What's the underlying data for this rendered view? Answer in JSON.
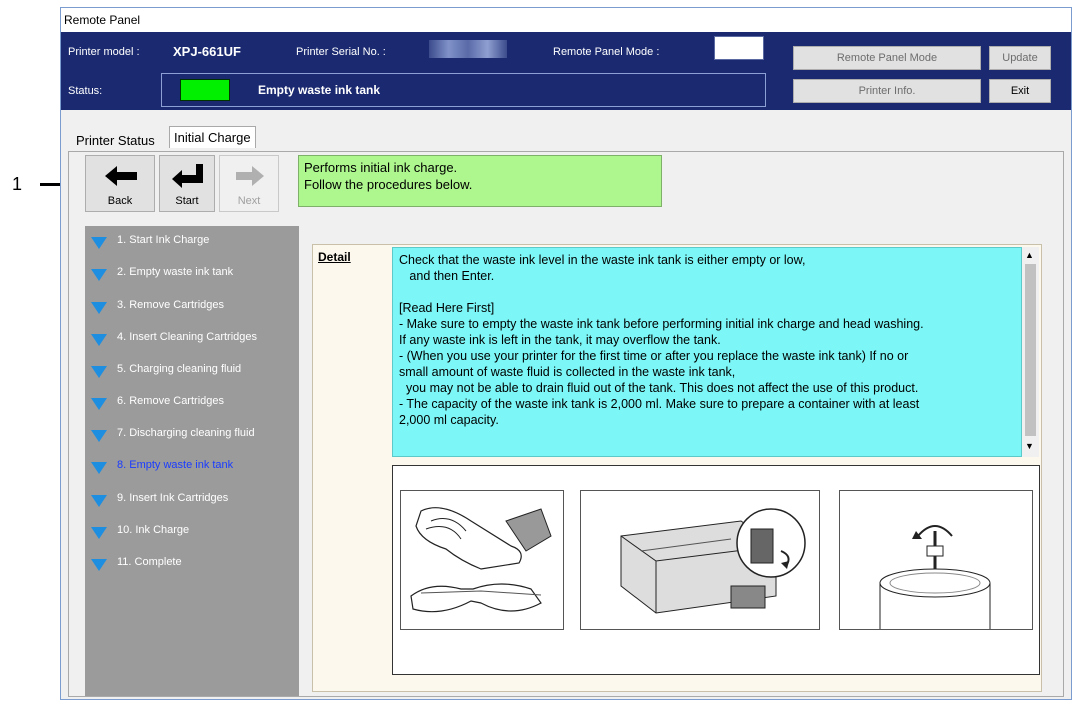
{
  "callout": {
    "number": "1"
  },
  "window": {
    "title": "Remote Panel"
  },
  "header": {
    "printer_model_label": "Printer model :",
    "printer_model_value": "XPJ-661UF",
    "serial_label": "Printer Serial No. :",
    "remote_mode_label": "Remote Panel Mode :",
    "status_label": "Status:",
    "status_text": "Empty waste ink tank",
    "status_color": "#00f000",
    "buttons": {
      "remote_panel_mode": "Remote Panel Mode",
      "update": "Update",
      "printer_info": "Printer Info.",
      "exit": "Exit"
    }
  },
  "tabs": [
    {
      "label": "Printer Status"
    },
    {
      "label": "Initial Charge"
    }
  ],
  "toolbar": {
    "back_label": "Back",
    "start_label": "Start",
    "next_label": "Next",
    "info_line1": "Performs initial ink charge.",
    "info_line2": "Follow the procedures below."
  },
  "steps": [
    {
      "label": "1. Start Ink Charge"
    },
    {
      "label": "2. Empty waste ink tank"
    },
    {
      "label": "3. Remove Cartridges"
    },
    {
      "label": "4. Insert Cleaning Cartridges"
    },
    {
      "label": "5. Charging cleaning fluid"
    },
    {
      "label": "6. Remove Cartridges"
    },
    {
      "label": "7. Discharging cleaning fluid"
    },
    {
      "label": "8. Empty waste ink tank",
      "active": true
    },
    {
      "label": "9. Insert Ink Cartridges"
    },
    {
      "label": "10. Ink Charge"
    },
    {
      "label": "11. Complete"
    }
  ],
  "detail": {
    "label": "Detail",
    "lines": [
      "Check that the waste ink level in the waste ink tank is either empty or low,",
      "   and then Enter.",
      "",
      "[Read Here First]",
      "- Make sure to empty the waste ink tank before performing initial ink charge and head washing.",
      "If any waste ink is left in the tank, it may overflow the tank.",
      "- (When you use your printer for the first time or after you replace the waste ink tank) If no or",
      "small amount of waste fluid is collected in the waste ink tank,",
      "  you may not be able to drain fluid out of the tank. This does not affect the use of this product.",
      "- The capacity of the waste ink tank is 2,000 ml. Make sure to prepare a container with at least",
      "2,000 ml capacity."
    ]
  },
  "colors": {
    "header_bg": "#1b2a70",
    "info_bg": "#aef78e",
    "detail_bg": "#7cf6f6",
    "steps_bg": "#9b9b9b",
    "active_step": "#1a3cff",
    "step_icon": "#1e8ee0"
  }
}
